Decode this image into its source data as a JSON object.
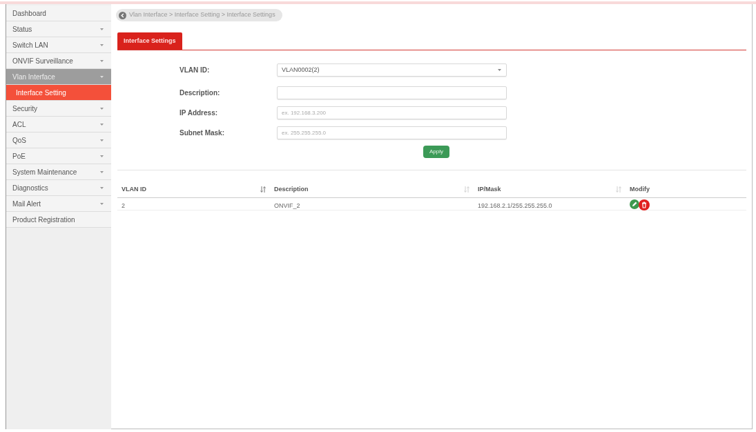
{
  "sidebar": {
    "items": [
      {
        "label": "Dashboard",
        "kind": "link",
        "selected": false
      },
      {
        "label": "Status",
        "kind": "menu",
        "selected": false,
        "expanded": false
      },
      {
        "label": "Switch LAN",
        "kind": "menu",
        "selected": false,
        "expanded": false
      },
      {
        "label": "ONVIF Surveillance",
        "kind": "menu",
        "selected": false,
        "expanded": false
      },
      {
        "label": "Vlan Interface",
        "kind": "menu",
        "selected": false,
        "expanded": true,
        "children": [
          {
            "label": "Interface Setting",
            "selected": true
          }
        ]
      },
      {
        "label": "Security",
        "kind": "menu",
        "selected": false,
        "expanded": false
      },
      {
        "label": "ACL",
        "kind": "menu",
        "selected": false,
        "expanded": false
      },
      {
        "label": "QoS",
        "kind": "menu",
        "selected": false,
        "expanded": false
      },
      {
        "label": "PoE",
        "kind": "menu",
        "selected": false,
        "expanded": false
      },
      {
        "label": "System Maintenance",
        "kind": "menu",
        "selected": false,
        "expanded": false
      },
      {
        "label": "Diagnostics",
        "kind": "menu",
        "selected": false,
        "expanded": false
      },
      {
        "label": "Mail Alert",
        "kind": "menu",
        "selected": false,
        "expanded": false
      },
      {
        "label": "Product Registration",
        "kind": "link",
        "selected": false
      }
    ]
  },
  "breadcrumb": {
    "text": "Vlan Interface > Interface Setting > Interface Settings"
  },
  "tabs": [
    {
      "label": "Interface Settings",
      "selected": true
    }
  ],
  "form": {
    "fields": [
      {
        "label": "VLAN ID:",
        "kind": "select",
        "value": "VLAN0002(2)"
      },
      {
        "label": "Description:",
        "kind": "text"
      },
      {
        "label": "IP Address:",
        "kind": "text",
        "placeholder": "ex. 192.168.3.200"
      },
      {
        "label": "Subnet Mask:",
        "kind": "text",
        "placeholder": "ex. 255.255.255.0"
      }
    ],
    "submit": "Apply"
  },
  "table": {
    "columns": [
      {
        "label": "VLAN ID",
        "sorted": true
      },
      {
        "label": "Description",
        "sorted": false
      },
      {
        "label": "IP/Mask",
        "sorted": false
      },
      {
        "label": "Modify"
      }
    ],
    "rows": [
      {
        "cells": [
          "2",
          "ONVIF_2",
          "192.168.2.1/255.255.255.0"
        ],
        "actions": [
          {
            "kind": "edit"
          },
          {
            "kind": "delete"
          }
        ]
      }
    ]
  }
}
